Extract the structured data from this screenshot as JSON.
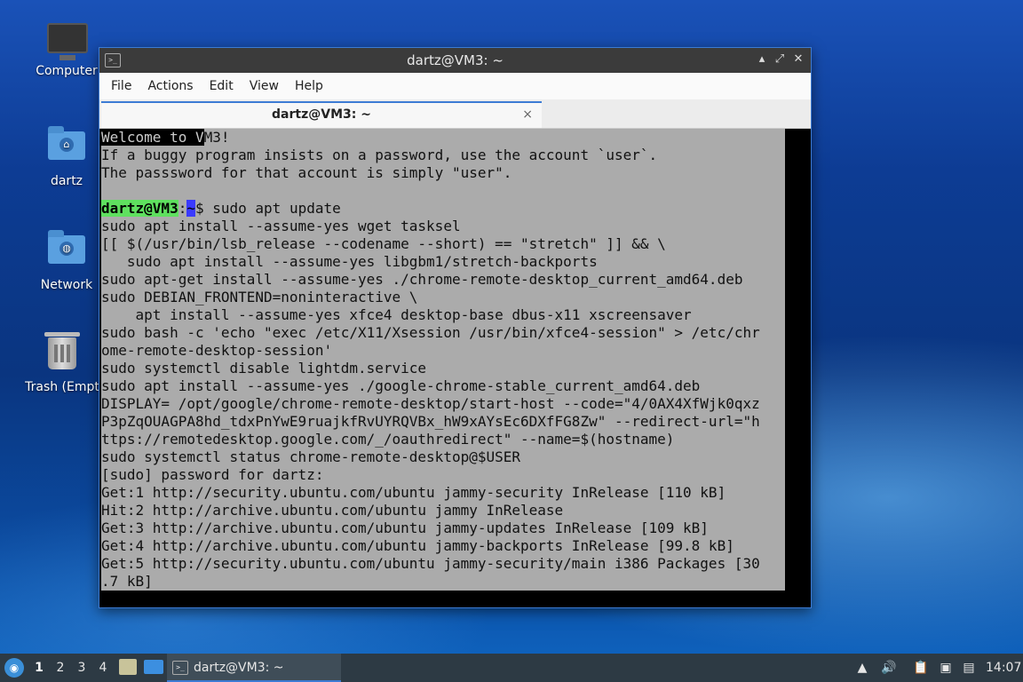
{
  "desktop": {
    "icons": [
      {
        "label": "Computer"
      },
      {
        "label": "dartz"
      },
      {
        "label": "Network"
      },
      {
        "label": "Trash (Empt"
      }
    ]
  },
  "window": {
    "title": "dartz@VM3: ~",
    "menu": [
      "File",
      "Actions",
      "Edit",
      "View",
      "Help"
    ],
    "tab_title": "dartz@VM3: ~",
    "tab_close": "×",
    "buttons": {
      "minimize": "▴",
      "maximize": "⤢",
      "close": "✕"
    }
  },
  "terminal": {
    "welcome_highlight": "Welcome to V",
    "welcome_rest": "M3!",
    "line2": "If a buggy program insists on a password, use the account `user`.",
    "line3": "The passsword for that account is simply \"user\".",
    "line4": "",
    "prompt_user": "dartz@VM3",
    "prompt_colon": ":",
    "prompt_path": "~",
    "prompt_cmd": "$ sudo apt update",
    "lines": [
      "sudo apt install --assume-yes wget tasksel",
      "[[ $(/usr/bin/lsb_release --codename --short) == \"stretch\" ]] && \\",
      "   sudo apt install --assume-yes libgbm1/stretch-backports",
      "sudo apt-get install --assume-yes ./chrome-remote-desktop_current_amd64.deb",
      "sudo DEBIAN_FRONTEND=noninteractive \\",
      "    apt install --assume-yes xfce4 desktop-base dbus-x11 xscreensaver",
      "sudo bash -c 'echo \"exec /etc/X11/Xsession /usr/bin/xfce4-session\" > /etc/chr",
      "ome-remote-desktop-session'",
      "sudo systemctl disable lightdm.service",
      "sudo apt install --assume-yes ./google-chrome-stable_current_amd64.deb",
      "DISPLAY= /opt/google/chrome-remote-desktop/start-host --code=\"4/0AX4XfWjk0qxz",
      "P3pZqOUAGPA8hd_tdxPnYwE9ruajkfRvUYRQVBx_hW9xAYsEc6DXfFG8Zw\" --redirect-url=\"h",
      "ttps://remotedesktop.google.com/_/oauthredirect\" --name=$(hostname)",
      "sudo systemctl status chrome-remote-desktop@$USER",
      "[sudo] password for dartz:",
      "Get:1 http://security.ubuntu.com/ubuntu jammy-security InRelease [110 kB]",
      "Hit:2 http://archive.ubuntu.com/ubuntu jammy InRelease",
      "Get:3 http://archive.ubuntu.com/ubuntu jammy-updates InRelease [109 kB]",
      "Get:4 http://archive.ubuntu.com/ubuntu jammy-backports InRelease [99.8 kB]",
      "Get:5 http://security.ubuntu.com/ubuntu jammy-security/main i386 Packages [30",
      ".7 kB]"
    ]
  },
  "taskbar": {
    "workspaces": [
      "1",
      "2",
      "3",
      "4"
    ],
    "task_label": "dartz@VM3: ~",
    "clock": "14:07"
  },
  "colors": {
    "accent": "#3c7bd4",
    "terminal_bg": "#ababab",
    "prompt_user_bg": "#5fe05f",
    "prompt_path_bg": "#3a3aff"
  }
}
